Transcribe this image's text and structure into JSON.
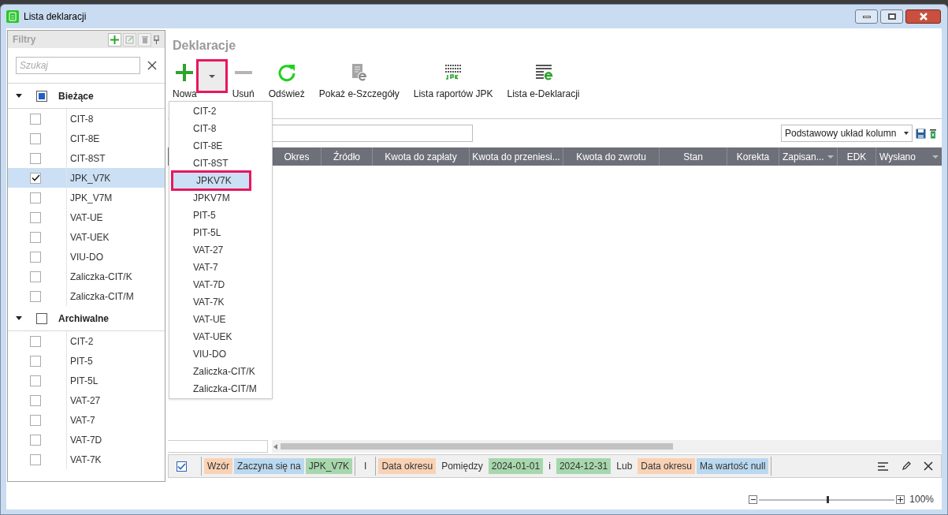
{
  "window": {
    "title": "Lista deklaracji"
  },
  "filters_panel": {
    "title": "Filtry",
    "search": {
      "placeholder": "Szukaj"
    },
    "groups": [
      {
        "label": "Bieżące",
        "expanded": true,
        "checked": false,
        "partial": true,
        "items": [
          {
            "label": "CIT-8",
            "checked": false,
            "selected": false
          },
          {
            "label": "CIT-8E",
            "checked": false,
            "selected": false
          },
          {
            "label": "CIT-8ST",
            "checked": false,
            "selected": false
          },
          {
            "label": "JPK_V7K",
            "checked": true,
            "selected": true
          },
          {
            "label": "JPK_V7M",
            "checked": false,
            "selected": false
          },
          {
            "label": "VAT-UE",
            "checked": false,
            "selected": false
          },
          {
            "label": "VAT-UEK",
            "checked": false,
            "selected": false
          },
          {
            "label": "VIU-DO",
            "checked": false,
            "selected": false
          },
          {
            "label": "Zaliczka-CIT/K",
            "checked": false,
            "selected": false
          },
          {
            "label": "Zaliczka-CIT/M",
            "checked": false,
            "selected": false
          }
        ]
      },
      {
        "label": "Archiwalne",
        "expanded": true,
        "checked": false,
        "partial": false,
        "items": [
          {
            "label": "CIT-2",
            "checked": false,
            "selected": false
          },
          {
            "label": "PIT-5",
            "checked": false,
            "selected": false
          },
          {
            "label": "PIT-5L",
            "checked": false,
            "selected": false
          },
          {
            "label": "VAT-27",
            "checked": false,
            "selected": false
          },
          {
            "label": "VAT-7",
            "checked": false,
            "selected": false
          },
          {
            "label": "VAT-7D",
            "checked": false,
            "selected": false
          },
          {
            "label": "VAT-7K",
            "checked": false,
            "selected": false
          }
        ]
      }
    ]
  },
  "section_title": "Deklaracje",
  "toolbar": [
    {
      "kind": "plus",
      "label": "Nowa",
      "disabled": false,
      "dropdown": true,
      "dropdown_highlighted": true
    },
    {
      "kind": "minus",
      "label": "Usuń",
      "disabled": true
    },
    {
      "kind": "refresh",
      "label": "Odśwież",
      "disabled": false
    },
    {
      "kind": "doc-e",
      "label": "Pokaż e-Szczegóły",
      "disabled": true
    },
    {
      "kind": "list-jpk",
      "label": "Lista raportów JPK",
      "disabled": false
    },
    {
      "kind": "list-e",
      "label": "Lista e-Deklaracji",
      "disabled": false
    }
  ],
  "new_menu": [
    {
      "label": "CIT-2",
      "selected": false,
      "highlighted": false
    },
    {
      "label": "CIT-8",
      "selected": false,
      "highlighted": false
    },
    {
      "label": "CIT-8E",
      "selected": false,
      "highlighted": false
    },
    {
      "label": "CIT-8ST",
      "selected": false,
      "highlighted": false
    },
    {
      "label": "JPKV7K",
      "selected": true,
      "highlighted": true
    },
    {
      "label": "JPKV7M",
      "selected": false,
      "highlighted": false
    },
    {
      "label": "PIT-5",
      "selected": false,
      "highlighted": false
    },
    {
      "label": "PIT-5L",
      "selected": false,
      "highlighted": false
    },
    {
      "label": "VAT-27",
      "selected": false,
      "highlighted": false
    },
    {
      "label": "VAT-7",
      "selected": false,
      "highlighted": false
    },
    {
      "label": "VAT-7D",
      "selected": false,
      "highlighted": false
    },
    {
      "label": "VAT-7K",
      "selected": false,
      "highlighted": false
    },
    {
      "label": "VAT-UE",
      "selected": false,
      "highlighted": false
    },
    {
      "label": "VAT-UEK",
      "selected": false,
      "highlighted": false
    },
    {
      "label": "VIU-DO",
      "selected": false,
      "highlighted": false
    },
    {
      "label": "Zaliczka-CIT/K",
      "selected": false,
      "highlighted": false
    },
    {
      "label": "Zaliczka-CIT/M",
      "selected": false,
      "highlighted": false
    }
  ],
  "grid": {
    "layout": "Podstawowy układ kolumn",
    "columns": [
      {
        "label": "Okres",
        "filter": false
      },
      {
        "label": "Źródło",
        "filter": false
      },
      {
        "label": "Kwota do zapłaty",
        "filter": false
      },
      {
        "label": "Kwota do przeniesi...",
        "filter": false
      },
      {
        "label": "Kwota do zwrotu",
        "filter": false
      },
      {
        "label": "Stan",
        "filter": false
      },
      {
        "label": "Korekta",
        "filter": false
      },
      {
        "label": "Zapisan...",
        "filter": true
      },
      {
        "label": "EDK",
        "filter": false
      },
      {
        "label": "Wysłano",
        "filter": true
      }
    ]
  },
  "filter_bar": {
    "enabled": true,
    "groups": [
      [
        {
          "kind": "field",
          "text": "Wzór"
        },
        {
          "kind": "operator",
          "text": "Zaczyna się na"
        },
        {
          "kind": "value",
          "text": "JPK_V7K"
        }
      ],
      {
        "kind": "plain",
        "text": "I"
      },
      [
        {
          "kind": "field",
          "text": "Data okresu"
        },
        {
          "kind": "plain",
          "text": "Pomiędzy"
        },
        {
          "kind": "value",
          "text": "2024-01-01"
        },
        {
          "kind": "plain",
          "text": "i"
        },
        {
          "kind": "value",
          "text": "2024-12-31"
        },
        {
          "kind": "plain",
          "text": "Lub"
        },
        {
          "kind": "field",
          "text": "Data okresu"
        },
        {
          "kind": "operator",
          "text": "Ma wartość null"
        }
      ]
    ]
  },
  "zoom": {
    "level": 0.51,
    "reading": "100%"
  }
}
